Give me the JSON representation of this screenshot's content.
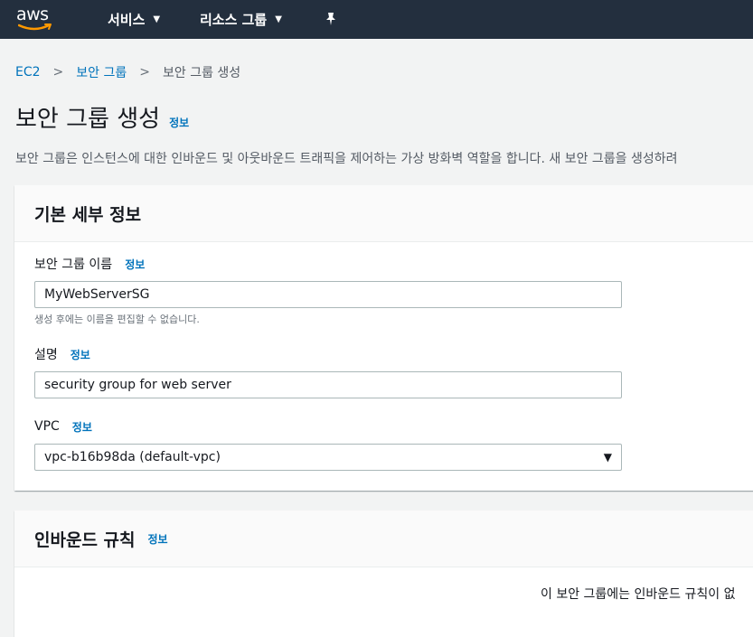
{
  "topnav": {
    "logo_text": "aws",
    "services": "서비스",
    "resource_groups": "리소스 그룹"
  },
  "breadcrumb": {
    "item1": "EC2",
    "item2": "보안 그룹",
    "current": "보안 그룹 생성"
  },
  "page": {
    "title": "보안 그룹 생성",
    "info": "정보",
    "description": "보안 그룹은 인스턴스에 대한 인바운드 및 아웃바운드 트래픽을 제어하는 가상 방화벽 역할을 합니다. 새 보안 그룹을 생성하려"
  },
  "basic_panel": {
    "title": "기본 세부 정보",
    "name_label": "보안 그룹 이름",
    "name_info": "정보",
    "name_value": "MyWebServerSG",
    "name_hint": "생성 후에는 이름을 편집할 수 없습니다.",
    "desc_label": "설명",
    "desc_info": "정보",
    "desc_value": "security group for web server",
    "vpc_label": "VPC",
    "vpc_info": "정보",
    "vpc_value": "vpc-b16b98da (default-vpc)"
  },
  "inbound_panel": {
    "title": "인바운드 규칙",
    "info": "정보",
    "empty_message": "이 보안 그룹에는 인바운드 규칙이 없"
  },
  "colors": {
    "nav_bg": "#232f3e",
    "link": "#0073bb",
    "page_bg": "#f2f3f3"
  }
}
